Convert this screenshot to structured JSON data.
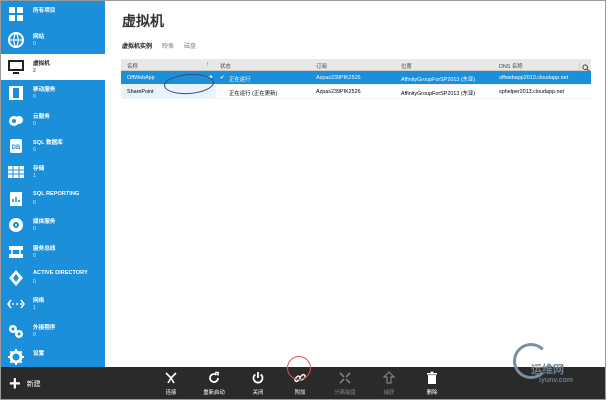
{
  "colors": {
    "accent": "#1b8fd9",
    "command_bar": "#2a2a2a"
  },
  "sidebar": {
    "items": [
      {
        "label": "所有项目",
        "count": "",
        "icon": "grid-icon"
      },
      {
        "label": "网站",
        "count": "0",
        "icon": "globe-icon"
      },
      {
        "label": "虚拟机",
        "count": "2",
        "icon": "monitor-icon",
        "active": true
      },
      {
        "label": "移动服务",
        "count": "0",
        "icon": "mobile-icon"
      },
      {
        "label": "云服务",
        "count": "0",
        "icon": "cloud-gear-icon"
      },
      {
        "label": "SQL 数据库",
        "count": "0",
        "icon": "database-icon"
      },
      {
        "label": "存储",
        "count": "1",
        "icon": "table-icon"
      },
      {
        "label": "SQL REPORTING",
        "count": "0",
        "icon": "report-icon"
      },
      {
        "label": "媒体服务",
        "count": "0",
        "icon": "media-icon"
      },
      {
        "label": "服务总线",
        "count": "0",
        "icon": "bus-icon"
      },
      {
        "label": "ACTIVE DIRECTORY",
        "count": "0",
        "icon": "directory-icon"
      },
      {
        "label": "网络",
        "count": "1",
        "icon": "network-icon"
      },
      {
        "label": "外接程序",
        "count": "0",
        "icon": "addon-icon"
      },
      {
        "label": "设置",
        "count": "",
        "icon": "gear-icon"
      }
    ]
  },
  "main": {
    "title": "虚拟机",
    "subtabs": [
      "虚拟机实例",
      "映像",
      "磁盘"
    ],
    "grid": {
      "columns": [
        "名称",
        "状态",
        "订阅",
        "位置",
        "DNS 名称"
      ],
      "rows": [
        {
          "name": "OffWebApp",
          "status": "正在运行",
          "subscription": "Azpas239PIK2526",
          "location": "AffinityGroupForSP2013 (东亚)",
          "dns": "offwebapp2013.cloudapp.net",
          "selected": true
        },
        {
          "name": "SharePoint",
          "status": "正在运行 (正在更新)",
          "subscription": "Azpas239PIK2526",
          "location": "AffinityGroupForSP2013 (东亚)",
          "dns": "sphelper2013.cloudapp.net",
          "selected": false
        }
      ]
    }
  },
  "commandbar": {
    "new_label": "新建",
    "commands": [
      {
        "label": "连接",
        "icon": "connect-icon",
        "enabled": true
      },
      {
        "label": "重新启动",
        "icon": "restart-icon",
        "enabled": true
      },
      {
        "label": "关闭",
        "icon": "power-icon",
        "enabled": true
      },
      {
        "label": "附加",
        "icon": "attach-icon",
        "enabled": true
      },
      {
        "label": "分离磁盘",
        "icon": "detach-icon",
        "enabled": false
      },
      {
        "label": "捕获",
        "icon": "capture-icon",
        "enabled": false
      },
      {
        "label": "删除",
        "icon": "trash-icon",
        "enabled": true
      }
    ]
  },
  "watermark": {
    "text": "运维网",
    "url": "iyunv.com"
  }
}
